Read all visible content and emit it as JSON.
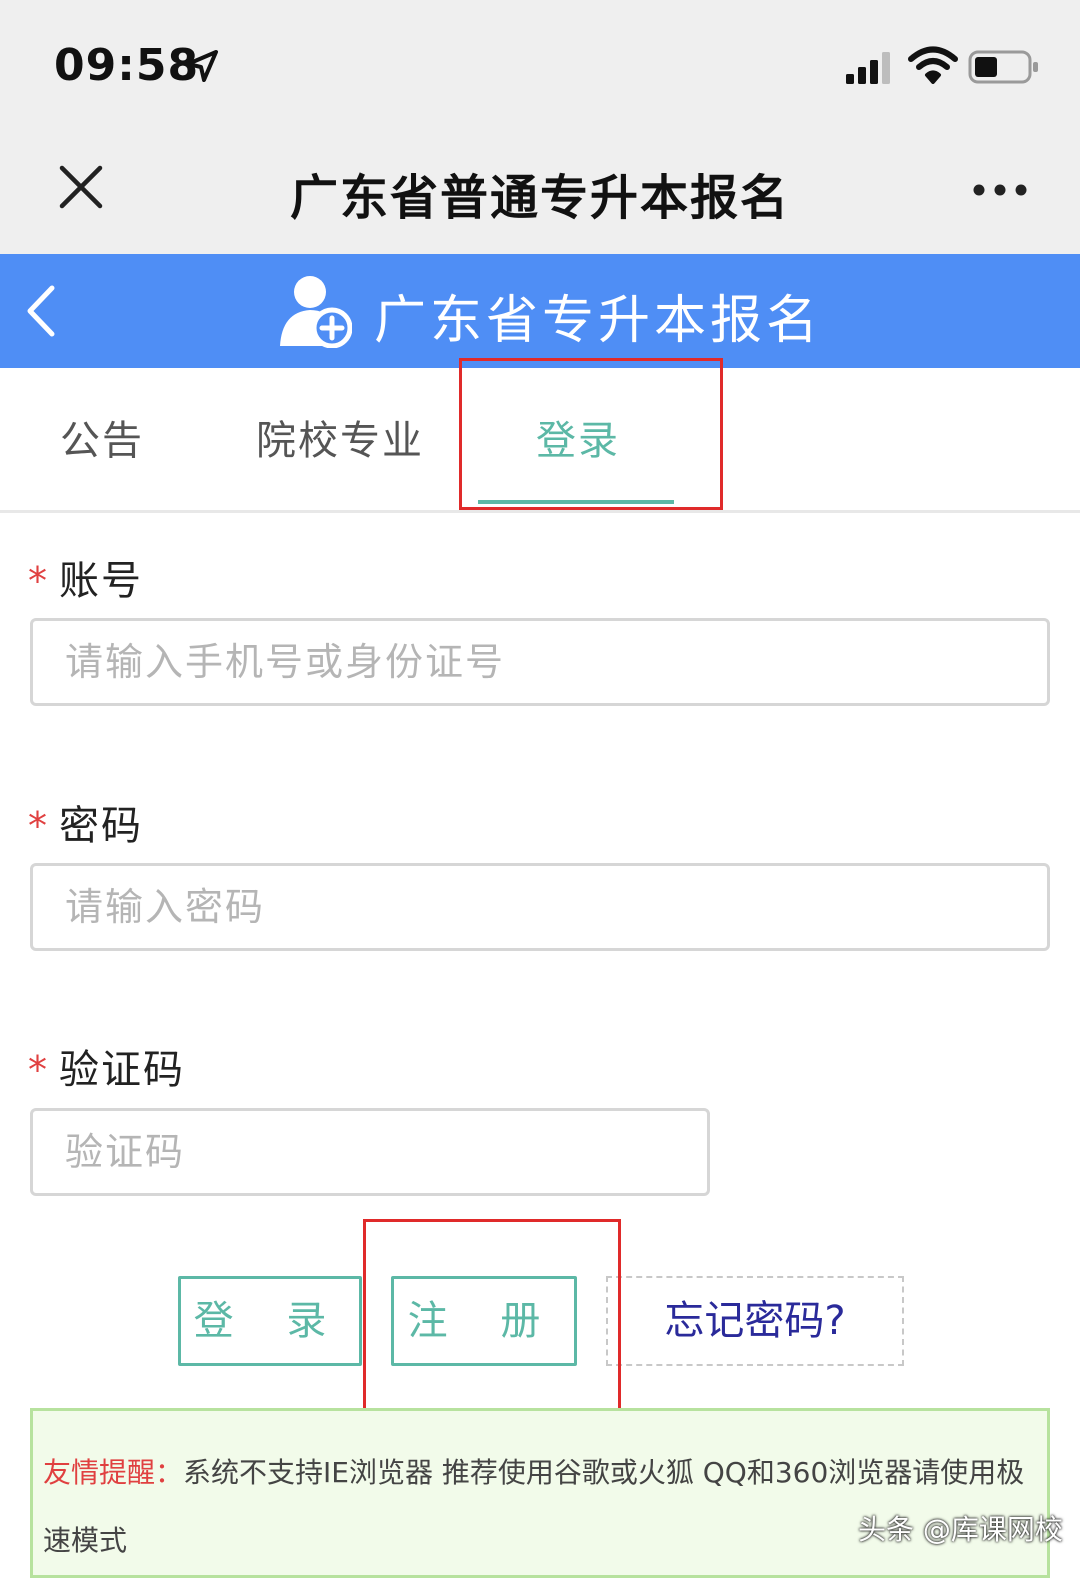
{
  "status_bar": {
    "time": "09:58",
    "location_icon": "location-arrow-icon",
    "signal_icon": "cellular-signal-icon",
    "wifi_icon": "wifi-icon",
    "battery_icon": "battery-icon"
  },
  "wechat_header": {
    "title": "广东省普通专升本报名",
    "close_icon": "close-icon",
    "more_icon": "more-dots-icon"
  },
  "site_header": {
    "title": "广东省专升本报名",
    "back_icon": "chevron-left-icon",
    "logo_icon": "user-add-icon",
    "bg_color": "#4f8ef5"
  },
  "tabs": [
    {
      "label": "公告",
      "active": false
    },
    {
      "label": "院校专业",
      "active": false
    },
    {
      "label": "登录",
      "active": true
    }
  ],
  "form": {
    "required_mark": "*",
    "account": {
      "label": "账号",
      "placeholder": "请输入手机号或身份证号",
      "value": ""
    },
    "password": {
      "label": "密码",
      "placeholder": "请输入密码",
      "value": ""
    },
    "captcha": {
      "label": "验证码",
      "placeholder": "验证码",
      "value": ""
    }
  },
  "buttons": {
    "login": "登 录",
    "register": "注 册",
    "forgot": "忘记密码?"
  },
  "notice": {
    "label": "友情提醒：",
    "text": "系统不支持IE浏览器 推荐使用谷歌或火狐 QQ和360浏览器请使用极速模式"
  },
  "watermark": "头条 @库课网校",
  "colors": {
    "accent": "#5cb8a6",
    "highlight_box": "#e02a2a",
    "required": "#e04040",
    "link": "#2a2a9a"
  }
}
